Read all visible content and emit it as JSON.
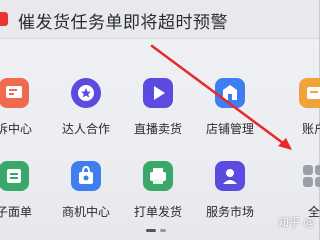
{
  "notice": {
    "text": "催发货任务单即将超时预警"
  },
  "rows": [
    [
      {
        "label": "诉中心",
        "icon": "complaint-icon",
        "color": "#ef6a4f"
      },
      {
        "label": "达人合作",
        "icon": "star-icon",
        "color": "#5b4be0"
      },
      {
        "label": "直播卖货",
        "icon": "play-icon",
        "color": "#5b4be0"
      },
      {
        "label": "店铺管理",
        "icon": "store-icon",
        "color": "#3f7ef0"
      },
      {
        "label": "账户",
        "icon": "account-icon",
        "color": "#f2a23a"
      }
    ],
    [
      {
        "label": "子面单",
        "icon": "waybill-icon",
        "color": "#3aa86a"
      },
      {
        "label": "商机中心",
        "icon": "bag-icon",
        "color": "#3f7ef0"
      },
      {
        "label": "打单发货",
        "icon": "print-icon",
        "color": "#3aa86a"
      },
      {
        "label": "服务市场",
        "icon": "user-card-icon",
        "color": "#5b4be0"
      },
      {
        "label": "全",
        "icon": "apps-icon",
        "color": "#9aa0aa"
      }
    ]
  ],
  "watermark": "知乎 @"
}
